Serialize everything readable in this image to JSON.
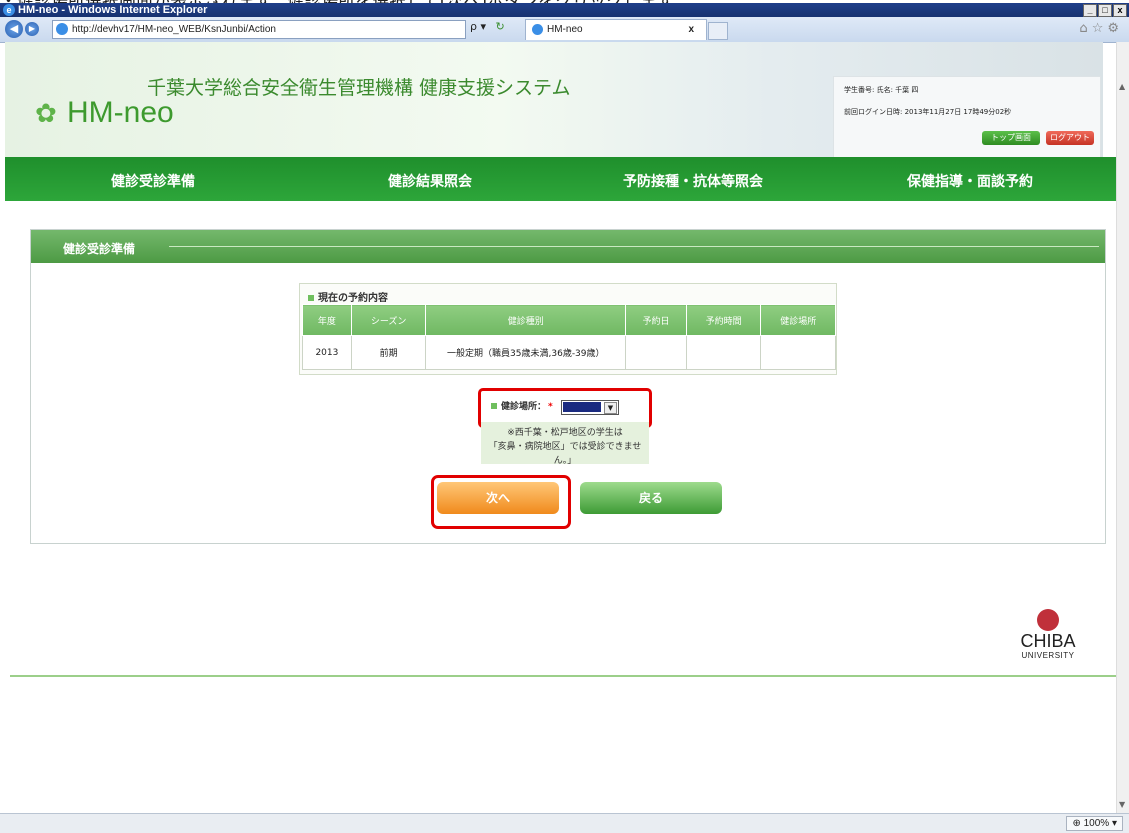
{
  "caption": "・健診場所選択画面が表示されます。健診場所を選択して[次へ]ボタンをクリックします。",
  "window": {
    "title": "HM-neo - Windows Internet Explorer",
    "buttons": [
      "_",
      "□",
      "x"
    ]
  },
  "browser": {
    "url": "http://devhv17/HM-neo_WEB/KsnJunbi/Action",
    "tab_title": "HM-neo",
    "tab_close": "x",
    "search_glyph": "ρ ▾",
    "refresh_glyph": "↻"
  },
  "header": {
    "org_title": "千葉大学総合安全衛生管理機構 健康支援システム",
    "logo_text": "HM-neo",
    "student_line": "学生番号: 氏名: 千葉 四",
    "login_line": "前回ログイン日時: 2013年11月27日 17時49分02秒",
    "top_button": "トップ画面",
    "logout_button": "ログアウト"
  },
  "nav": {
    "items": [
      "健診受診準備",
      "健診結果照会",
      "予防接種・抗体等照会",
      "保健指導・面談予約"
    ]
  },
  "section": {
    "title": "健診受診準備"
  },
  "reservation": {
    "caption": "現在の予約内容",
    "columns": [
      "年度",
      "シーズン",
      "健診種別",
      "予約日",
      "予約時間",
      "健診場所"
    ],
    "rows": [
      [
        "2013",
        "前期",
        "一般定期（職員35歳未満,36歳-39歳）",
        "",
        "",
        ""
      ]
    ]
  },
  "location": {
    "label": "健診場所：",
    "required": "*",
    "value": ""
  },
  "note": {
    "line1": "※西千葉・松戸地区の学生は",
    "line2": "「亥鼻・病院地区」では受診できません。」"
  },
  "buttons": {
    "next": "次へ",
    "back": "戻る"
  },
  "logo": {
    "word": "CHIBA",
    "sub": "UNIVERSITY"
  },
  "status": {
    "zoom": "100%"
  }
}
